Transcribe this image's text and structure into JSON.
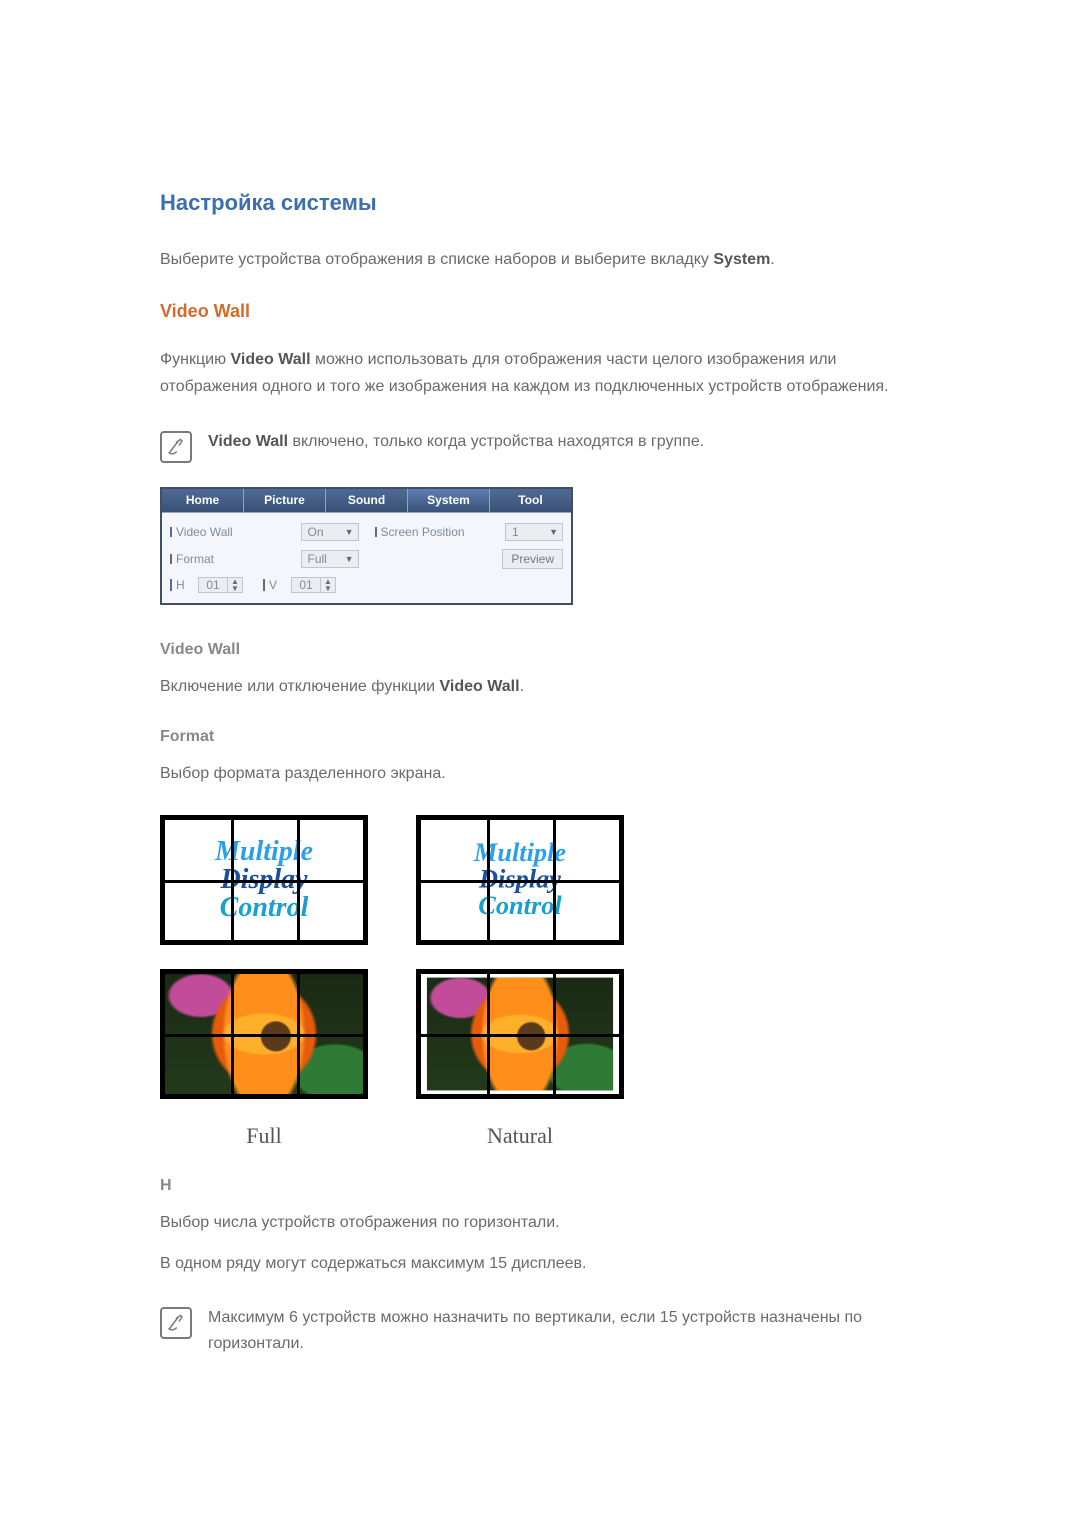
{
  "headings": {
    "section": "Настройка системы",
    "video_wall": "Video Wall"
  },
  "paragraphs": {
    "intro_pre": "Выберите устройства отображения в списке наборов и выберите вкладку ",
    "intro_bold": "System",
    "intro_post": ".",
    "vw_desc_pre": "Функцию ",
    "vw_desc_bold": "Video Wall",
    "vw_desc_post": " можно использовать для отображения части целого изображения или отображения одного и того же изображения на каждом из подключенных устройств отображения.",
    "vw_toggle_desc_pre": "Включение или отключение функции ",
    "vw_toggle_desc_bold": "Video Wall",
    "vw_toggle_desc_post": ".",
    "format_desc": "Выбор формата разделенного экрана.",
    "h_desc": "Выбор числа устройств отображения по горизонтали.",
    "h_row_limit": "В одном ряду могут содержаться максимум 15 дисплеев."
  },
  "notes": {
    "vw_group_pre": "",
    "vw_group_bold": "Video Wall",
    "vw_group_post": " включено, только когда устройства находятся в группе.",
    "h_limit": "Максимум 6 устройств можно назначить по вертикали, если 15 устройств назначены по горизонтали."
  },
  "subsections": {
    "video_wall": "Video Wall",
    "format": "Format",
    "h": "H"
  },
  "panel": {
    "tabs": [
      "Home",
      "Picture",
      "Sound",
      "System",
      "Tool"
    ],
    "active_tab_index": 3,
    "fields": {
      "video_wall_label": "Video Wall",
      "video_wall_value": "On",
      "screen_position_label": "Screen Position",
      "screen_position_value": "1",
      "format_label": "Format",
      "format_value": "Full",
      "preview_button": "Preview",
      "h_label": "H",
      "h_value": "01",
      "v_label": "V",
      "v_value": "01"
    }
  },
  "figure": {
    "mdc_line1": "Multiple",
    "mdc_line2": "Display",
    "mdc_line3": "Control",
    "caption_full": "Full",
    "caption_natural": "Natural"
  }
}
